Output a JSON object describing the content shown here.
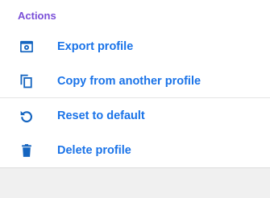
{
  "colors": {
    "header": "#7a4fd8",
    "label": "#1a73e8",
    "icon": "#1565c0"
  },
  "menu": {
    "section_title": "Actions",
    "items": [
      {
        "label": "Export profile",
        "icon": "export-icon"
      },
      {
        "label": "Copy from another profile",
        "icon": "copy-icon"
      },
      {
        "label": "Reset to default",
        "icon": "reset-icon"
      },
      {
        "label": "Delete profile",
        "icon": "delete-icon"
      }
    ]
  }
}
